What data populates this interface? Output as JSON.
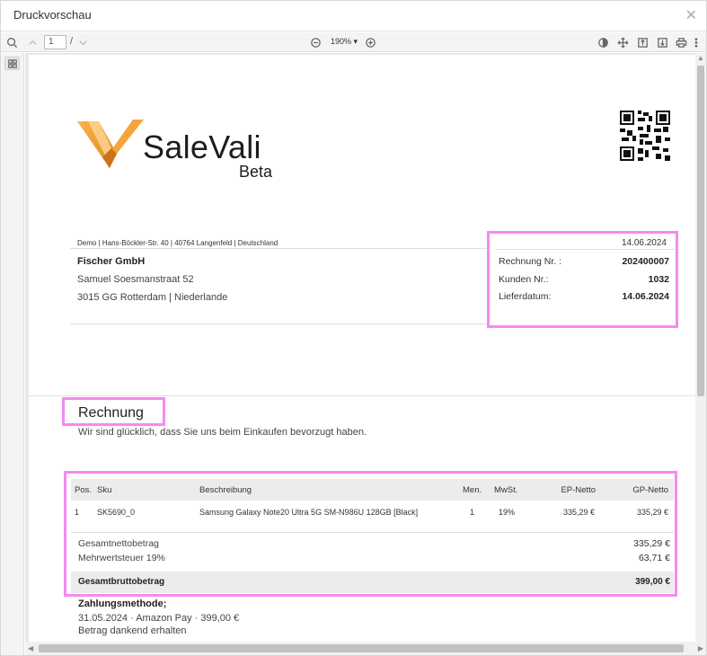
{
  "dialog": {
    "title": "Druckvorschau",
    "close_glyph": "✕"
  },
  "toolbar": {
    "page_current": "1",
    "page_separator": "/",
    "zoom_label": "190% ▾"
  },
  "document": {
    "logo": {
      "brand": "SaleVali",
      "tag": "Beta",
      "accent": "#f2a33a"
    },
    "sender_line": "Demo | Hans-Böckler-Str. 40 | 40764 Langenfeld | Deutschland",
    "recipient": {
      "name": "Fischer GmbH",
      "street": "Samuel Soesmanstraat 52",
      "city": "3015 GG Rotterdam | Niederlande"
    },
    "meta": {
      "date": "14.06.2024",
      "rows": [
        {
          "label": "Rechnung Nr. :",
          "value": "202400007"
        },
        {
          "label": "Kunden Nr.:",
          "value": "1032"
        },
        {
          "label": "Lieferdatum:",
          "value": "14.06.2024"
        }
      ]
    },
    "title": "Rechnung",
    "intro": "Wir sind glücklich, dass Sie uns beim Einkaufen bevorzugt haben.",
    "table": {
      "columns": [
        "Pos.",
        "Sku",
        "Beschreibung",
        "Men.",
        "MwSt.",
        "EP-Netto",
        "GP-Netto"
      ],
      "rows": [
        [
          "1",
          "SK5690_0",
          "Samsung Galaxy Note20 Ultra 5G SM-N986U 128GB [Black]",
          "1",
          "19%",
          "335,29 €",
          "335,29 €"
        ]
      ],
      "net_label": "Gesamtnettobetrag",
      "net_value": "335,29 €",
      "tax_label": "Mehrwertsteuer 19%",
      "tax_value": "63,71 €",
      "gross_label": "Gesamtbruttobetrag",
      "gross_value": "399,00 €"
    },
    "payment": {
      "heading": "Zahlungsmethode;",
      "line1": "31.05.2024 · Amazon Pay · 399,00 €",
      "line2": "Betrag dankend erhalten"
    }
  },
  "colors": {
    "highlight": "#f58af0"
  }
}
